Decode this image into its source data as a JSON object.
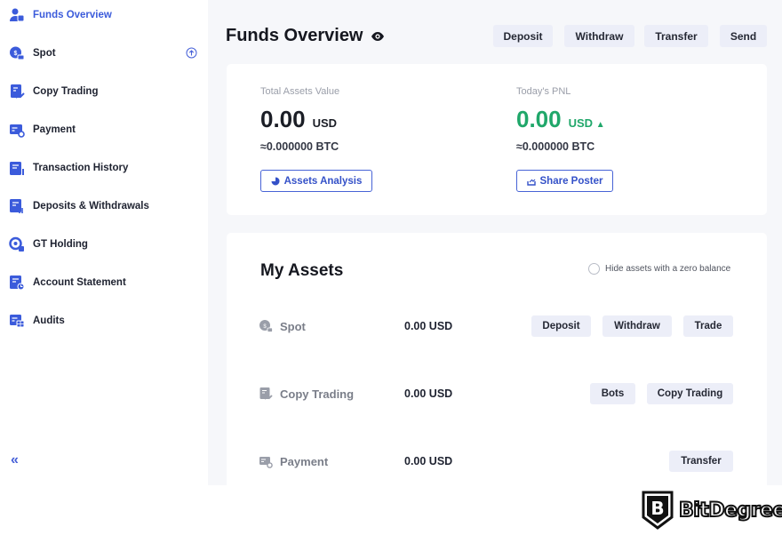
{
  "sidebar": {
    "items": [
      {
        "label": "Funds Overview",
        "icon": "user-wallet-icon",
        "active": true
      },
      {
        "label": "Spot",
        "icon": "spot-coin-icon",
        "active": false
      },
      {
        "label": "Copy Trading",
        "icon": "copy-trading-icon",
        "active": false
      },
      {
        "label": "Payment",
        "icon": "payment-card-icon",
        "active": false
      },
      {
        "label": "Transaction History",
        "icon": "transaction-history-icon",
        "active": false
      },
      {
        "label": "Deposits & Withdrawals",
        "icon": "deposits-withdrawals-icon",
        "active": false
      },
      {
        "label": "GT Holding",
        "icon": "gt-holding-icon",
        "active": false
      },
      {
        "label": "Account Statement",
        "icon": "account-statement-icon",
        "active": false
      },
      {
        "label": "Audits",
        "icon": "audits-icon",
        "active": false
      }
    ],
    "collapse_glyph": "«"
  },
  "header": {
    "title": "Funds Overview",
    "buttons": [
      "Deposit",
      "Withdraw",
      "Transfer",
      "Send"
    ]
  },
  "summary": {
    "total": {
      "label": "Total Assets Value",
      "value": "0.00",
      "currency": "USD",
      "btc": "≈0.000000 BTC",
      "button": "Assets Analysis"
    },
    "pnl": {
      "label": "Today's PNL",
      "value": "0.00",
      "currency": "USD",
      "trend": "▲",
      "btc": "≈0.000000 BTC",
      "button": "Share Poster"
    }
  },
  "my_assets": {
    "title": "My Assets",
    "hide_zero_label": "Hide assets with a zero balance",
    "hide_zero_checked": false,
    "rows": [
      {
        "name": "Spot",
        "value": "0.00 USD",
        "buttons": [
          "Deposit",
          "Withdraw",
          "Trade"
        ]
      },
      {
        "name": "Copy Trading",
        "value": "0.00 USD",
        "buttons": [
          "Bots",
          "Copy Trading"
        ]
      },
      {
        "name": "Payment",
        "value": "0.00 USD",
        "buttons": [
          "Transfer"
        ]
      }
    ]
  },
  "watermark": {
    "text": "BitDegree"
  },
  "colors": {
    "accent": "#3b5bdb",
    "positive": "#20a76a",
    "button_bg": "#eceef8",
    "page_bg": "#f6f7fa"
  }
}
